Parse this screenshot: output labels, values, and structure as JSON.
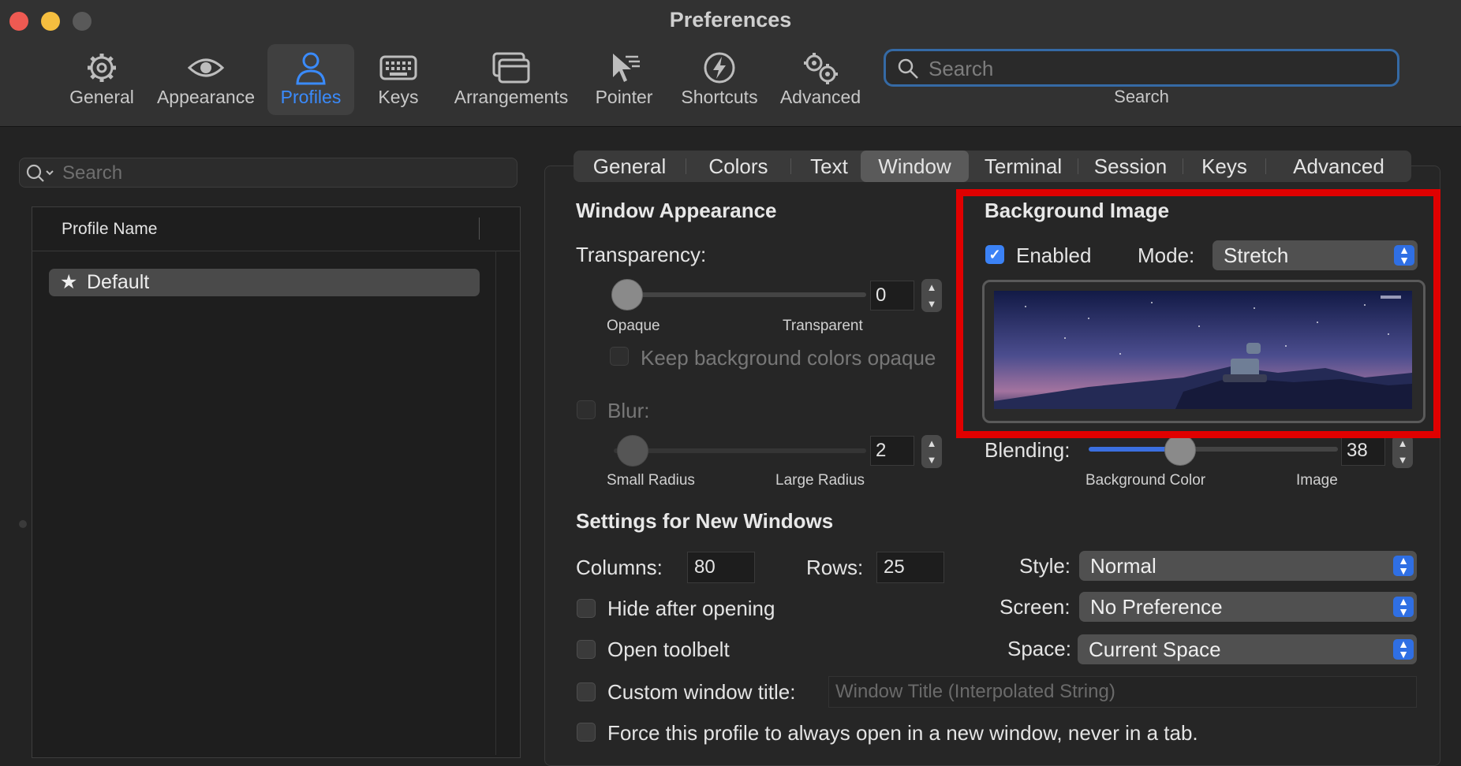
{
  "window": {
    "title": "Preferences"
  },
  "toolbar": {
    "items": [
      {
        "label": "General",
        "icon": "gear-icon"
      },
      {
        "label": "Appearance",
        "icon": "eye-icon"
      },
      {
        "label": "Profiles",
        "icon": "person-icon",
        "selected": true
      },
      {
        "label": "Keys",
        "icon": "keyboard-icon"
      },
      {
        "label": "Arrangements",
        "icon": "windows-icon"
      },
      {
        "label": "Pointer",
        "icon": "pointer-icon"
      },
      {
        "label": "Shortcuts",
        "icon": "lightning-icon"
      },
      {
        "label": "Advanced",
        "icon": "gears-icon"
      }
    ],
    "search": {
      "placeholder": "Search",
      "caption": "Search"
    }
  },
  "profiles": {
    "search_placeholder": "Search",
    "column_header": "Profile Name",
    "items": [
      {
        "name": "Default",
        "starred": true
      }
    ]
  },
  "tabs": [
    "General",
    "Colors",
    "Text",
    "Window",
    "Terminal",
    "Session",
    "Keys",
    "Advanced"
  ],
  "selected_tab": "Window",
  "window_appearance": {
    "heading": "Window Appearance",
    "transparency_label": "Transparency:",
    "transparency_value": "0",
    "opaque_label": "Opaque",
    "transparent_label": "Transparent",
    "keep_bg_opaque_label": "Keep background colors opaque",
    "blur_label": "Blur:",
    "blur_value": "2",
    "small_radius_label": "Small Radius",
    "large_radius_label": "Large Radius"
  },
  "background_image": {
    "heading": "Background Image",
    "enabled_label": "Enabled",
    "enabled": true,
    "mode_label": "Mode:",
    "mode_value": "Stretch",
    "blending_label": "Blending:",
    "blending_value": "38",
    "bg_color_label": "Background Color",
    "image_label": "Image",
    "highlight_color": "#e00000"
  },
  "new_windows": {
    "heading": "Settings for New Windows",
    "columns_label": "Columns:",
    "columns_value": "80",
    "rows_label": "Rows:",
    "rows_value": "25",
    "style_label": "Style:",
    "style_value": "Normal",
    "screen_label": "Screen:",
    "screen_value": "No Preference",
    "space_label": "Space:",
    "space_value": "Current Space",
    "hide_after_opening_label": "Hide after opening",
    "open_toolbelt_label": "Open toolbelt",
    "custom_title_label": "Custom window title:",
    "custom_title_placeholder": "Window Title (Interpolated String)",
    "force_new_window_label": "Force this profile to always open in a new window, never in a tab."
  },
  "colors": {
    "accent": "#3a8bfd",
    "checkbox_on": "#3b82f6",
    "popup_arrow": "#2f6fe4"
  }
}
